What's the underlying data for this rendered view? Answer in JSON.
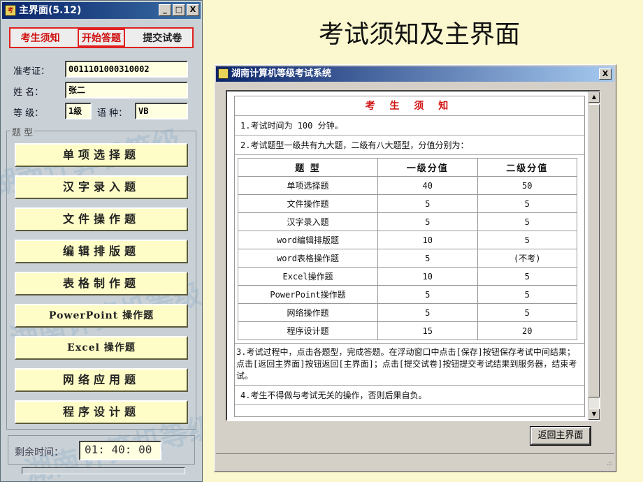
{
  "slide": {
    "title": "考试须知及主界面"
  },
  "main_window": {
    "title": "主界面(5.12)",
    "controls": {
      "minimize": "_",
      "maximize": "□",
      "close": "X"
    },
    "tabs": [
      {
        "label": "考生须知"
      },
      {
        "label": "开始答题"
      },
      {
        "label": "提交试卷"
      }
    ],
    "info": {
      "exam_id_label": "准考证：",
      "exam_id": "0011101000310002",
      "name_label": "姓  名：",
      "name": "张二",
      "level_label": "等  级：",
      "level": "1级",
      "lang_label": "语 种：",
      "lang": "VB"
    },
    "group_label": "题  型",
    "question_buttons": [
      {
        "label": "单项选择题"
      },
      {
        "label": "汉字录入题"
      },
      {
        "label": "文件操作题"
      },
      {
        "label": "编辑排版题"
      },
      {
        "label": "表格制作题"
      },
      {
        "label": "PowerPoint 操作题"
      },
      {
        "label": "Excel 操作题"
      },
      {
        "label": "网络应用题"
      },
      {
        "label": "程序设计题"
      }
    ],
    "timer": {
      "label": "剩余时间：",
      "value": "01: 40: 00",
      "progress": 0.0
    }
  },
  "dialog": {
    "title": "湖南计算机等级考试系统",
    "close": "X",
    "heading": "考 生 须 知",
    "line1": "1.考试时间为 100 分钟。",
    "line2": "2.考试题型一级共有九大题，二级有八大题型，分值分别为：",
    "table": {
      "headers": [
        "题  型",
        "一级分值",
        "二级分值"
      ],
      "rows": [
        [
          "单项选择题",
          "40",
          "50"
        ],
        [
          "文件操作题",
          "5",
          "5"
        ],
        [
          "汉字录入题",
          "5",
          "5"
        ],
        [
          "word编辑排版题",
          "10",
          "5"
        ],
        [
          "word表格操作题",
          "5",
          "(不考)"
        ],
        [
          "Excel操作题",
          "10",
          "5"
        ],
        [
          "PowerPoint操作题",
          "5",
          "5"
        ],
        [
          "网络操作题",
          "5",
          "5"
        ],
        [
          "程序设计题",
          "15",
          "20"
        ]
      ]
    },
    "line3": "3.考试过程中，点击各题型，完成答题。在浮动窗口中点击[保存]按钮保存考试中间结果；点击[返回主界面]按钮返回[主界面]；点击[提交试卷]按钮提交考试结果到服务器，结束考试。",
    "line4": "4.考生不得做与考试无关的操作，否则后果自负。",
    "back_button": "返回主界面",
    "scroll_up": "▲",
    "scroll_down": "▼"
  }
}
